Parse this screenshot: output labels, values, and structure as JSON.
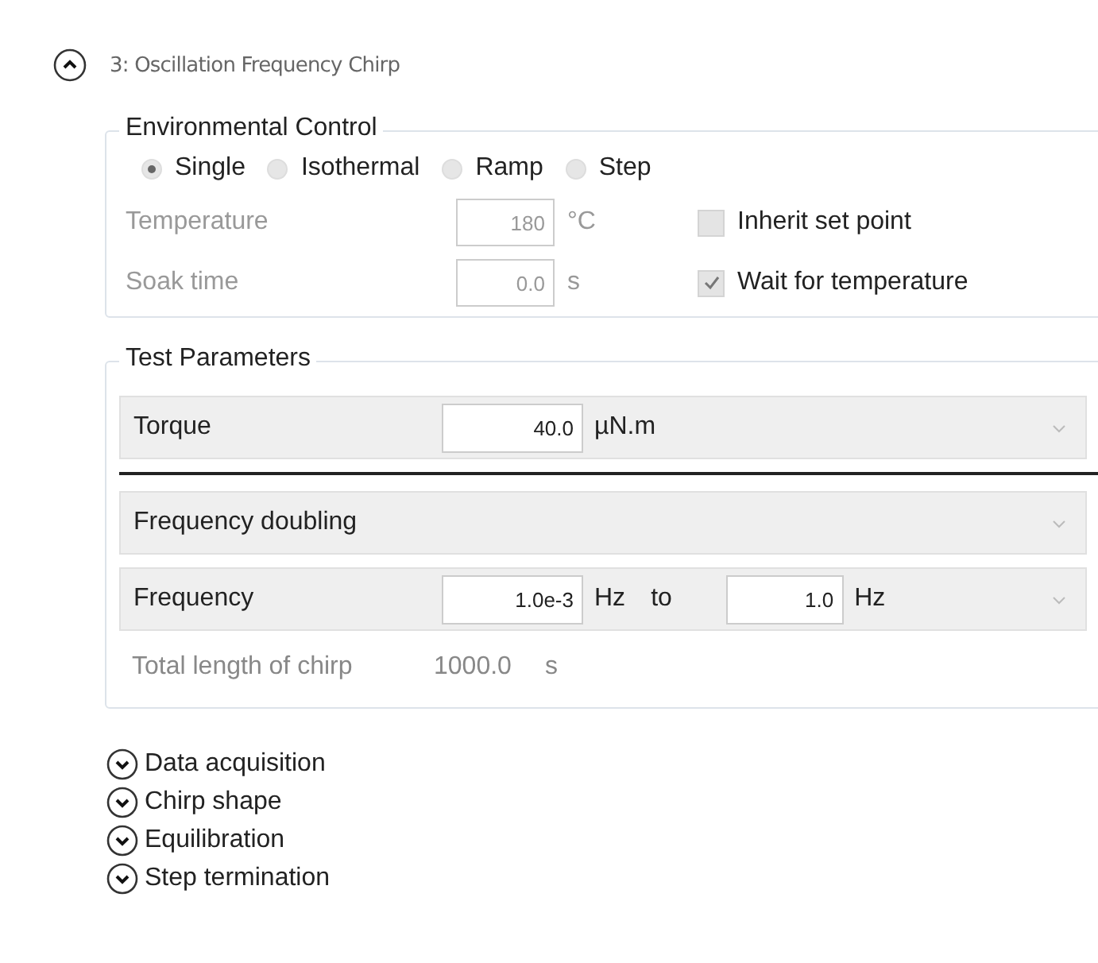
{
  "step": {
    "title": "3: Oscillation Frequency Chirp",
    "expanded": true
  },
  "environmental_control": {
    "title": "Environmental Control",
    "modes": [
      {
        "label": "Single",
        "selected": true
      },
      {
        "label": "Isothermal",
        "selected": false
      },
      {
        "label": "Ramp",
        "selected": false
      },
      {
        "label": "Step",
        "selected": false
      }
    ],
    "fields": [
      {
        "label": "Temperature",
        "value": "180",
        "unit": "°C",
        "disabled": true
      },
      {
        "label": "Soak time",
        "value": "0.0",
        "unit": "s",
        "disabled": true
      }
    ],
    "checkboxes": [
      {
        "label": "Inherit set point",
        "checked": false
      },
      {
        "label": "Wait for temperature",
        "checked": true
      }
    ]
  },
  "test_parameters": {
    "title": "Test Parameters",
    "rows": [
      {
        "kind": "value",
        "label": "Torque",
        "value": "40.0",
        "unit": "µN.m"
      },
      {
        "kind": "option",
        "label": "Frequency doubling"
      },
      {
        "kind": "range",
        "label": "Frequency",
        "value": "1.0e-3",
        "unit": "Hz",
        "joiner": "to",
        "value_2": "1.0",
        "unit_2": "Hz"
      }
    ],
    "summary": {
      "label": "Total length of chirp",
      "value": "1000.0",
      "unit": "s"
    }
  },
  "sections": [
    {
      "label": "Data acquisition",
      "expanded": false
    },
    {
      "label": "Chirp shape",
      "expanded": false
    },
    {
      "label": "Equilibration",
      "expanded": false
    },
    {
      "label": "Step termination",
      "expanded": false
    }
  ]
}
